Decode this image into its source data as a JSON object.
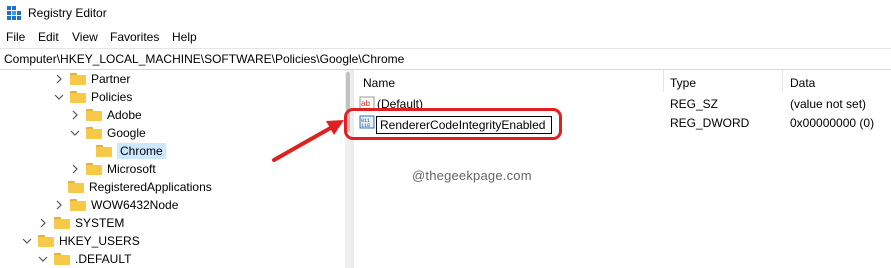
{
  "window": {
    "title": "Registry Editor"
  },
  "menu": [
    "File",
    "Edit",
    "View",
    "Favorites",
    "Help"
  ],
  "address": "Computer\\HKEY_LOCAL_MACHINE\\SOFTWARE\\Policies\\Google\\Chrome",
  "tree": [
    {
      "label": "Partner",
      "icon": "folder-icon",
      "expander": "chevron-right-icon"
    },
    {
      "label": "Policies",
      "icon": "folder-icon",
      "expander": "chevron-down-icon"
    },
    {
      "label": "Adobe",
      "icon": "folder-icon",
      "expander": "chevron-right-icon"
    },
    {
      "label": "Google",
      "icon": "folder-icon",
      "expander": "chevron-down-icon"
    },
    {
      "label": "Chrome",
      "icon": "folder-icon",
      "expander": "",
      "selected": true
    },
    {
      "label": "Microsoft",
      "icon": "folder-icon",
      "expander": "chevron-right-icon"
    },
    {
      "label": "RegisteredApplications",
      "icon": "folder-icon",
      "expander": ""
    },
    {
      "label": "WOW6432Node",
      "icon": "folder-icon",
      "expander": "chevron-right-icon"
    },
    {
      "label": "SYSTEM",
      "icon": "folder-icon",
      "expander": "chevron-right-icon"
    },
    {
      "label": "HKEY_USERS",
      "icon": "folder-icon",
      "expander": "chevron-down-icon"
    },
    {
      "label": ".DEFAULT",
      "icon": "folder-icon",
      "expander": "chevron-down-icon"
    }
  ],
  "list": {
    "columns": [
      "Name",
      "Type",
      "Data"
    ],
    "rows": [
      {
        "name": "(Default)",
        "type": "REG_SZ",
        "data": "(value not set)",
        "icon": "string-value-icon"
      },
      {
        "name": "RendererCodeIntegrityEnabled",
        "type": "REG_DWORD",
        "data": "0x00000000 (0)",
        "icon": "binary-value-icon",
        "editing": true
      }
    ]
  },
  "watermark": "@thegeekpage.com",
  "colors": {
    "highlight": "#e02020",
    "selection": "#cce8ff",
    "folder": "#f7c948"
  }
}
